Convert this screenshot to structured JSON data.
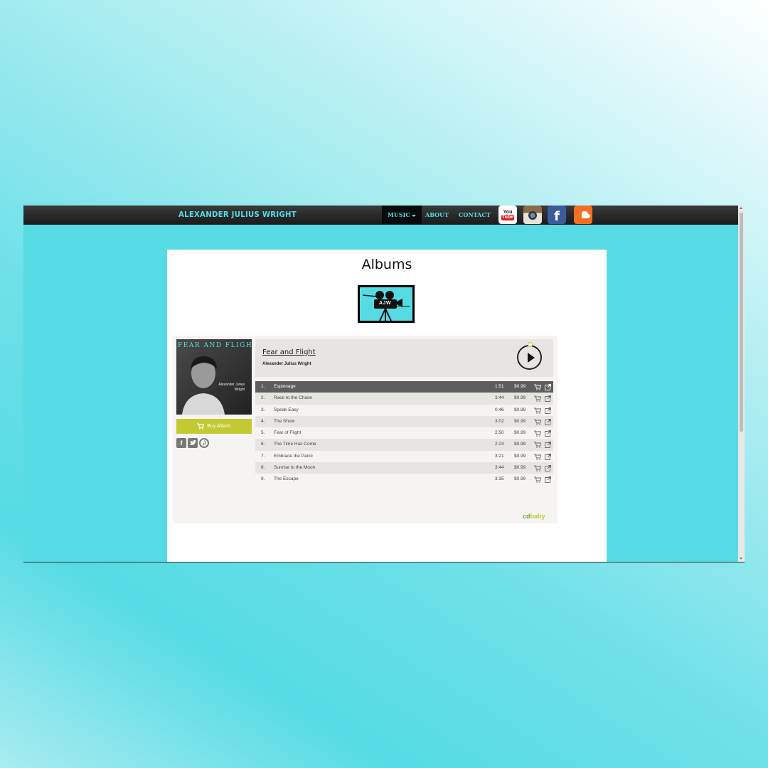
{
  "nav": {
    "brand": "Alexander Julius Wright",
    "links": [
      {
        "label": "Music",
        "active": true,
        "dropdown": true
      },
      {
        "label": "About",
        "active": false
      },
      {
        "label": "Contact",
        "active": false
      }
    ],
    "social": [
      {
        "name": "youtube-icon",
        "text": "You Tube"
      },
      {
        "name": "instagram-icon"
      },
      {
        "name": "facebook-icon",
        "text": "f"
      },
      {
        "name": "soundcloud-icon"
      }
    ]
  },
  "page": {
    "title": "Albums",
    "logo_text": "AJW"
  },
  "album": {
    "cover_title": "FEAR AND FLIGHT",
    "cover_artist": "Alexander Julius Wright",
    "title": "Fear and Flight",
    "artist": "Alexander Julius Wright",
    "buy_label": "Buy Album",
    "tracks": [
      {
        "num": "1.",
        "title": "Espionage",
        "duration": "1:51",
        "price": "$0.99"
      },
      {
        "num": "2.",
        "title": "Race to the Chase",
        "duration": "3:44",
        "price": "$0.99"
      },
      {
        "num": "3.",
        "title": "Speak Easy",
        "duration": "0:46",
        "price": "$0.99"
      },
      {
        "num": "4.",
        "title": "The Show",
        "duration": "3:02",
        "price": "$0.99"
      },
      {
        "num": "5.",
        "title": "Fear of Flight",
        "duration": "2:50",
        "price": "$0.99"
      },
      {
        "num": "6.",
        "title": "The Time Has Come",
        "duration": "2:24",
        "price": "$0.99"
      },
      {
        "num": "7.",
        "title": "Embrace the Panic",
        "duration": "3:21",
        "price": "$0.99"
      },
      {
        "num": "8.",
        "title": "Sunrise to the Moon",
        "duration": "3:44",
        "price": "$0.99"
      },
      {
        "num": "9.",
        "title": "The Escape",
        "duration": "3:35",
        "price": "$0.99"
      }
    ],
    "active_track": 0,
    "vendor": {
      "cd": "cd",
      "baby": "baby"
    }
  },
  "colors": {
    "accent": "#56dbe4",
    "buy": "#c2ca31"
  }
}
